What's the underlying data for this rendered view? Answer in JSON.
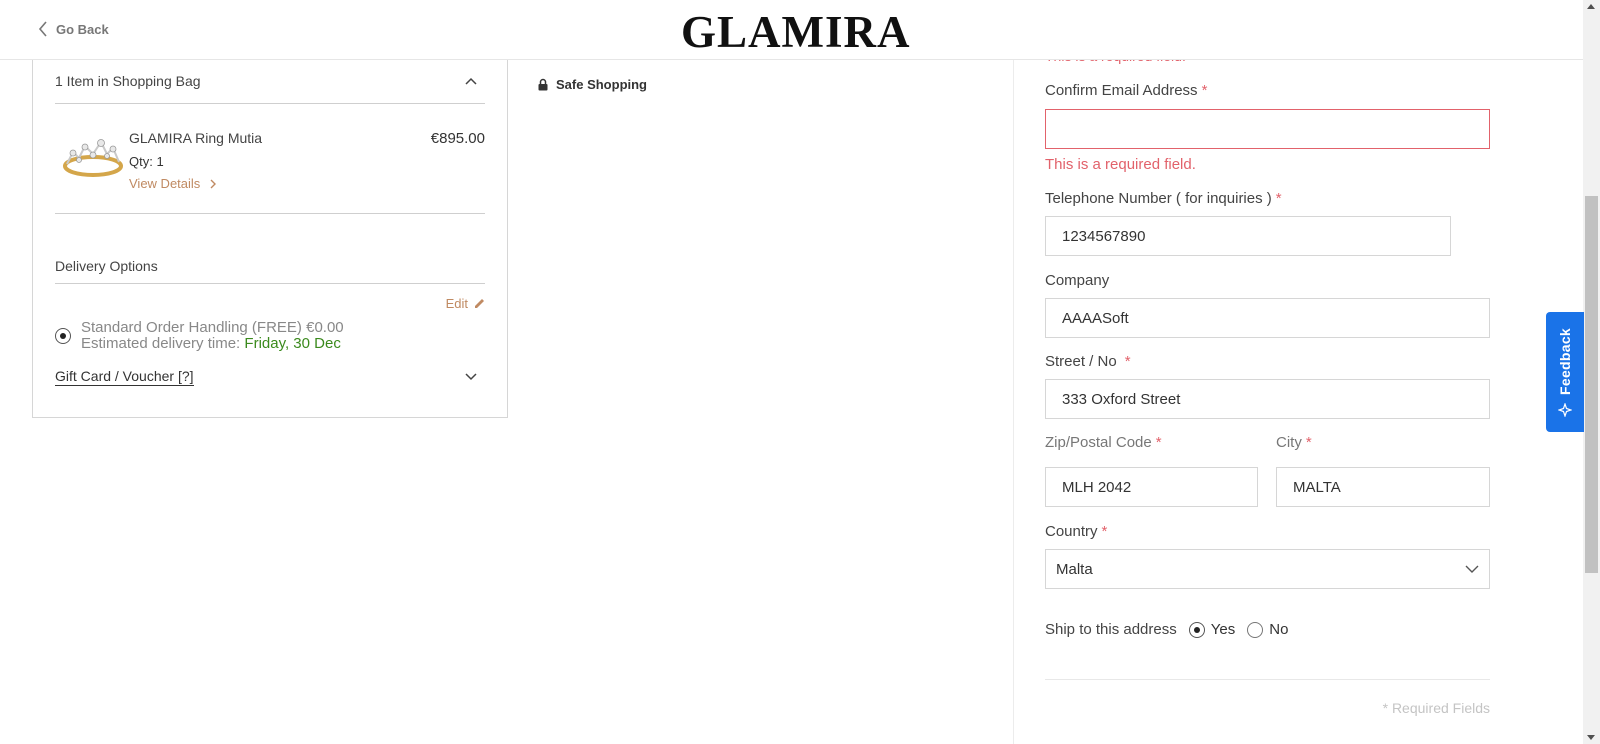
{
  "header": {
    "back_label": "Go Back",
    "logo_text": "GLAMIRA"
  },
  "bag": {
    "header_label": "1 Item in Shopping Bag",
    "item": {
      "name": "GLAMIRA Ring Mutia",
      "qty_label": "Qty: 1",
      "details_label": "View Details",
      "price": "€895.00"
    },
    "delivery_title": "Delivery Options",
    "edit_label": "Edit",
    "delivery_option_line1": "Standard Order Handling (FREE) €0.00",
    "delivery_estimate_label": "Estimated delivery time:",
    "delivery_date": "Friday, 30 Dec",
    "gift_card_label": "Gift Card / Voucher [?]"
  },
  "safe_shopping_label": "Safe Shopping",
  "form": {
    "top_error": "This is a required field.",
    "confirm_email": {
      "label": "Confirm Email Address",
      "value": "",
      "error": "This is a required field."
    },
    "telephone": {
      "label": "Telephone Number ( for inquiries )",
      "value": "1234567890"
    },
    "company": {
      "label": "Company",
      "value": "AAAASoft"
    },
    "street": {
      "label": "Street / No",
      "value": "333 Oxford Street"
    },
    "zip": {
      "label": "Zip/Postal Code",
      "value": "MLH 2042"
    },
    "city": {
      "label": "City",
      "value": "MALTA"
    },
    "country": {
      "label": "Country",
      "value": "Malta"
    },
    "ship_label": "Ship to this address",
    "ship_yes": "Yes",
    "ship_no": "No",
    "required_fields_note": "* Required Fields",
    "required_marker": "*"
  },
  "feedback_label": "Feedback",
  "colors": {
    "accent_gold": "#c08a62",
    "error_red": "#e2626b",
    "date_green": "#3b8a1d",
    "feedback_blue": "#1a73e8"
  },
  "icons": {
    "back": "chevron-left-icon",
    "collapse": "chevron-up-icon",
    "expand": "chevron-down-icon",
    "details": "chevron-right-icon",
    "edit": "pencil-icon",
    "safe": "lock-icon",
    "feedback": "sparkle-icon"
  }
}
